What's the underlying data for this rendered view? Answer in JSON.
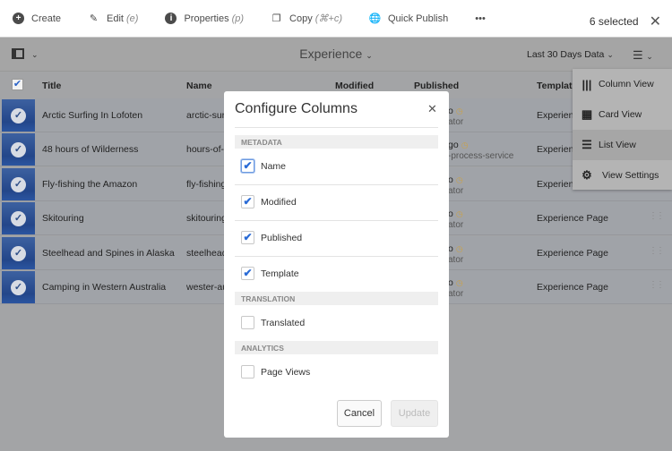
{
  "toolbar": {
    "create": "Create",
    "edit": "Edit",
    "edit_key": "(e)",
    "properties": "Properties",
    "properties_key": "(p)",
    "copy": "Copy",
    "copy_key": "(⌘+c)",
    "quick_publish": "Quick Publish",
    "more": "•••",
    "selected": "6 selected"
  },
  "viewbar": {
    "title": "Experience",
    "range": "Last 30 Days Data"
  },
  "table": {
    "headers": {
      "title": "Title",
      "name": "Name",
      "modified": "Modified",
      "published": "Published",
      "template": "Template"
    },
    "rows": [
      {
        "title": "Arctic Surfing In Lofoten",
        "name": "arctic-surf",
        "pub1": "o",
        "pub2": "ator",
        "template": "Experience"
      },
      {
        "title": "48 hours of Wilderness",
        "name": "hours-of-w",
        "pub1": "go",
        "pub2": "-process-service",
        "template": "Experience"
      },
      {
        "title": "Fly-fishing the Amazon",
        "name": "fly-fishing-",
        "pub1": "o",
        "pub2": "ator",
        "template": "Experience"
      },
      {
        "title": "Skitouring",
        "name": "skitouring",
        "pub1": "o",
        "pub2": "ator",
        "template": "Experience Page"
      },
      {
        "title": "Steelhead and Spines in Alaska",
        "name": "steelhead-",
        "pub1": "o",
        "pub2": "ator",
        "template": "Experience Page"
      },
      {
        "title": "Camping in Western Australia",
        "name": "wester-au",
        "pub1": "o",
        "pub2": "ator",
        "template": "Experience Page"
      }
    ]
  },
  "view_menu": {
    "items": [
      "Column View",
      "Card View",
      "List View",
      "View Settings"
    ],
    "active": "List View"
  },
  "dialog": {
    "title": "Configure Columns",
    "sections": {
      "metadata": "METADATA",
      "translation": "TRANSLATION",
      "analytics": "ANALYTICS"
    },
    "options": [
      {
        "label": "Name",
        "checked": true
      },
      {
        "label": "Modified",
        "checked": true
      },
      {
        "label": "Published",
        "checked": true
      },
      {
        "label": "Template",
        "checked": true
      },
      {
        "label": "Translated",
        "checked": false
      },
      {
        "label": "Page Views",
        "checked": false
      }
    ],
    "cancel": "Cancel",
    "update": "Update"
  },
  "colors": {
    "accent": "#2a6bd6",
    "thumbnail": "#23468a"
  }
}
